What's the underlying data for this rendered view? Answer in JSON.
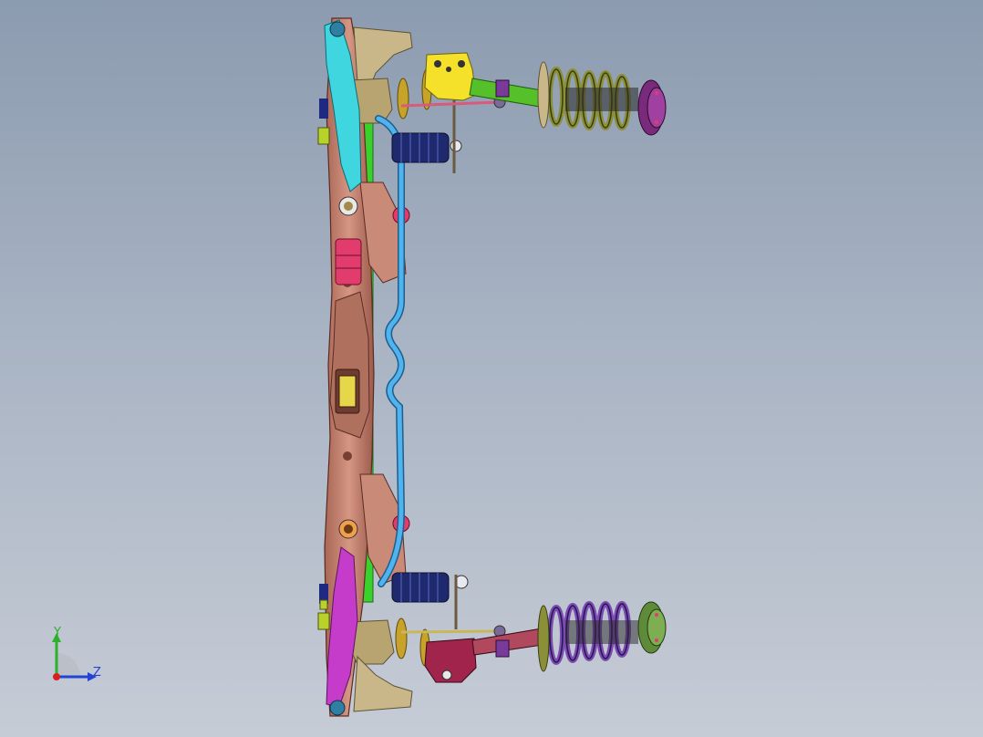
{
  "viewport": {
    "background_top": "#8c9bb0",
    "background_bottom": "#c6ccd6"
  },
  "model": {
    "part_colors": {
      "subframe": "#c98a78",
      "subframe_dark": "#8c4a3e",
      "bracket_green": "#39d12b",
      "control_arm_cyan": "#3fd6e0",
      "control_arm_magenta": "#c43cc9",
      "stabilizer_bar": "#4fb3ef",
      "bushing_pink": "#e13c6c",
      "tie_rod": "#d95a7a",
      "strut_green": "#55c02a",
      "spring": "#8a8f38",
      "spring_purple": "#7a4bb3",
      "knuckle_yellow": "#f5e02a",
      "knuckle_maroon": "#a0244c",
      "mount_tan": "#c9b78a",
      "shock_navy": "#1f2a6e"
    }
  },
  "triad": {
    "y_label": "Y",
    "z_label": "Z",
    "y_color": "#2bb12b",
    "z_color": "#2343d6",
    "x_color": "#d92020"
  }
}
